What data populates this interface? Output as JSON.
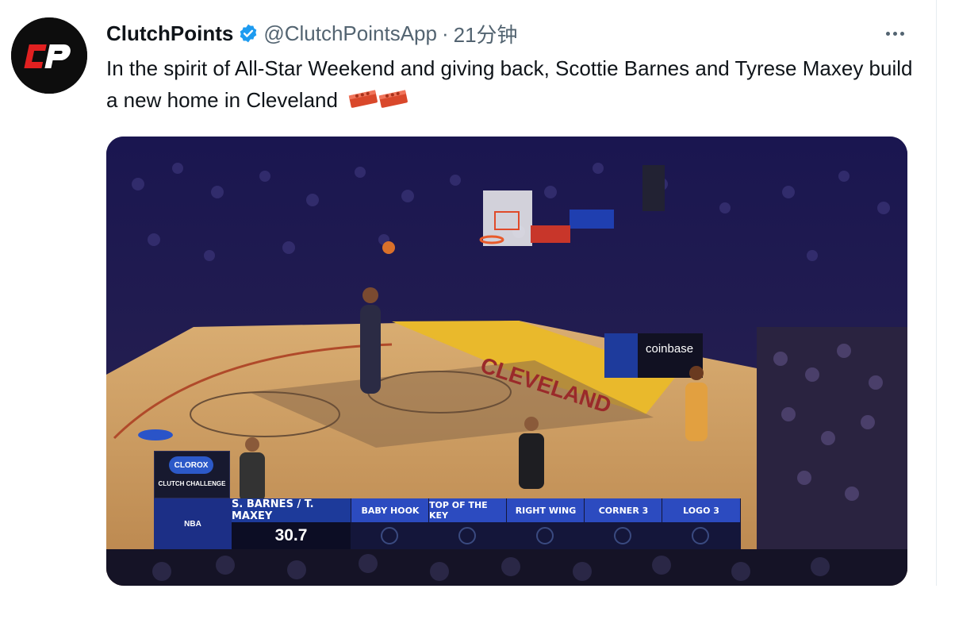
{
  "tweet": {
    "display_name": "ClutchPoints",
    "handle": "@ClutchPointsApp",
    "separator": "·",
    "time": "21分钟",
    "avatar_text": "CP",
    "text": "In the spirit of All-Star Weekend and giving back, Scottie Barnes and Tyrese Maxey build a new home in Cleveland",
    "emoji_icon": "brick-icon",
    "verified_icon": "verified-badge-icon",
    "more_icon": "more-options-icon"
  },
  "media": {
    "court_text": "CLEVELAND",
    "sponsor_board": "coinbase",
    "challenge": {
      "brand": "CLOROX",
      "label": "CLUTCH CHALLENGE"
    },
    "scorebar": {
      "logo_text": "NBA",
      "team": "S. BARNES / T. MAXEY",
      "time": "30.7",
      "spots": [
        "BABY HOOK",
        "TOP OF THE KEY",
        "RIGHT WING",
        "CORNER 3",
        "LOGO 3"
      ]
    }
  },
  "colors": {
    "accent": "#1d9bf0",
    "court_yellow": "#e9b92c",
    "court_wood": "#c99a5e",
    "scorebar_blue": "#2c4bc0"
  }
}
